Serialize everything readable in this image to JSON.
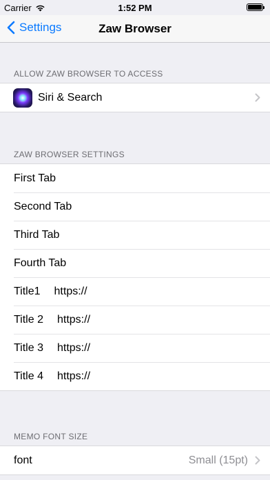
{
  "status_bar": {
    "carrier": "Carrier",
    "time": "1:52 PM"
  },
  "nav": {
    "back_label": "Settings",
    "title": "Zaw Browser"
  },
  "access_section": {
    "header": "ALLOW ZAW BROWSER TO ACCESS",
    "siri_label": "Siri & Search"
  },
  "settings_section": {
    "header": "ZAW BROWSER SETTINGS",
    "tabs": [
      "First Tab",
      "Second Tab",
      "Third Tab",
      "Fourth Tab"
    ],
    "titles": [
      {
        "name": "Title1",
        "url": "https://"
      },
      {
        "name": "Title 2",
        "url": "https://"
      },
      {
        "name": "Title 3",
        "url": "https://"
      },
      {
        "name": "Title 4",
        "url": "https://"
      }
    ]
  },
  "memo_section": {
    "header": "MEMO FONT SIZE",
    "font_label": "font",
    "font_value": "Small (15pt)"
  },
  "colors": {
    "accent": "#0a7aff",
    "background": "#efeff4",
    "secondary_text": "#8e8e93"
  }
}
